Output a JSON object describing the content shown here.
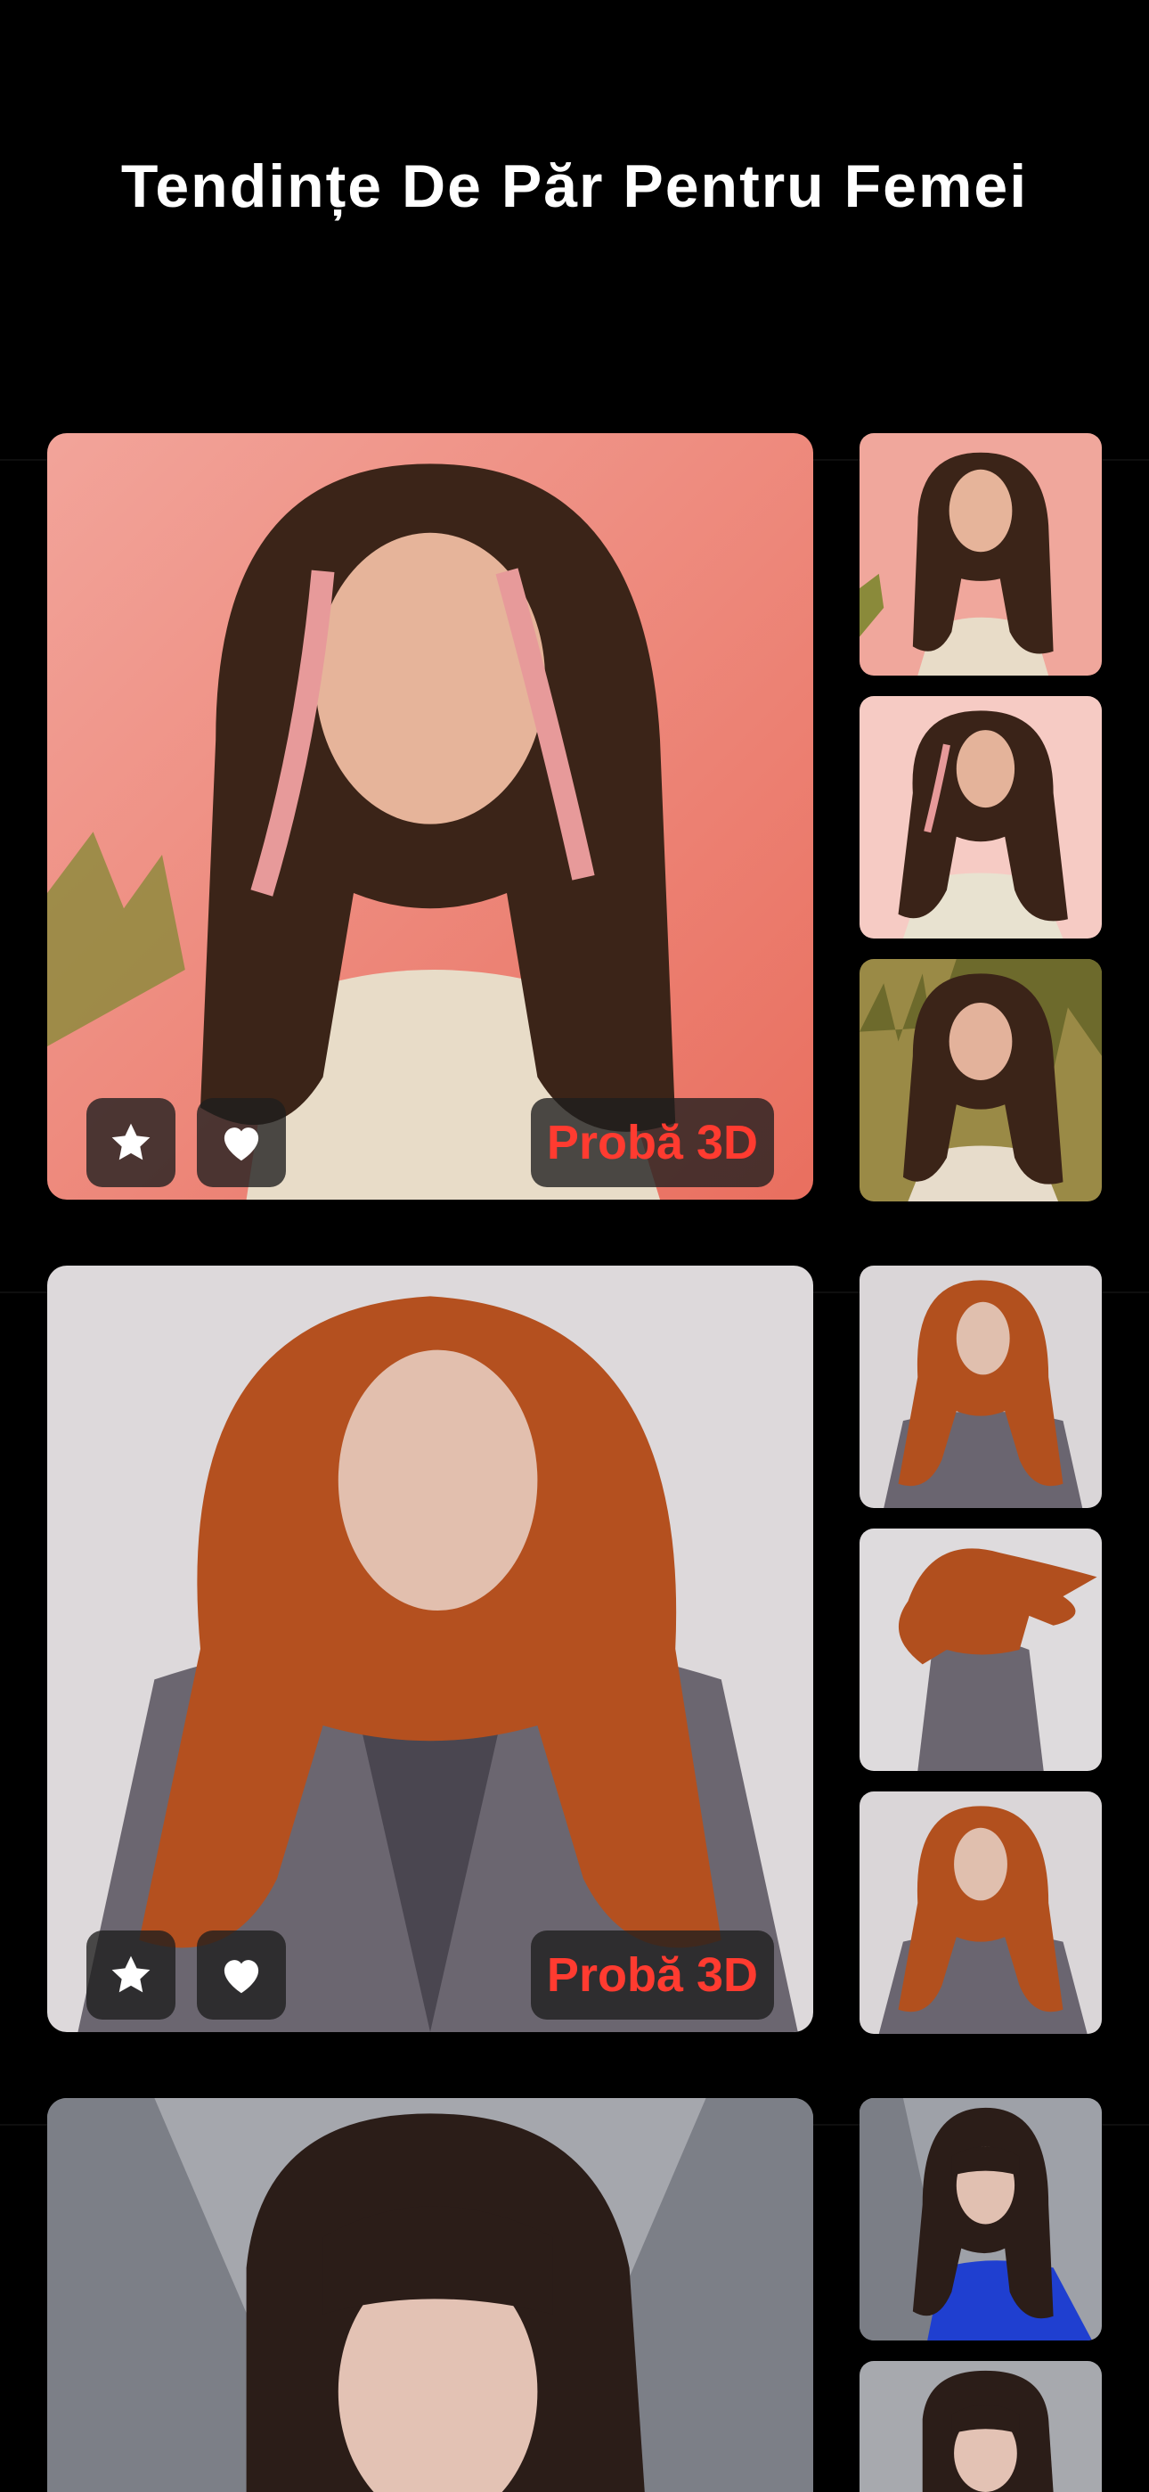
{
  "header": {
    "title": "Tendințe De Păr Pentru Femei"
  },
  "accent_color": "#ff3b30",
  "icons": {
    "favorite": "star-icon",
    "like": "heart-icon"
  },
  "looks": [
    {
      "hair": "pink-highlights-long-waves",
      "main_photo_alt": "Femeie cu păr lung ondulat șaten cu șuvițe roz",
      "try_label": "Probă 3D",
      "thumbnails": 3
    },
    {
      "hair": "long-curly-copper",
      "main_photo_alt": "Femeie cu păr lung creț aramiu",
      "try_label": "Probă 3D",
      "thumbnails": 3
    },
    {
      "hair": "dark-brown-with-bangs",
      "main_photo_alt": "Femeie cu păr castaniu închis cu breton",
      "try_label": "",
      "thumbnails": 2
    }
  ]
}
